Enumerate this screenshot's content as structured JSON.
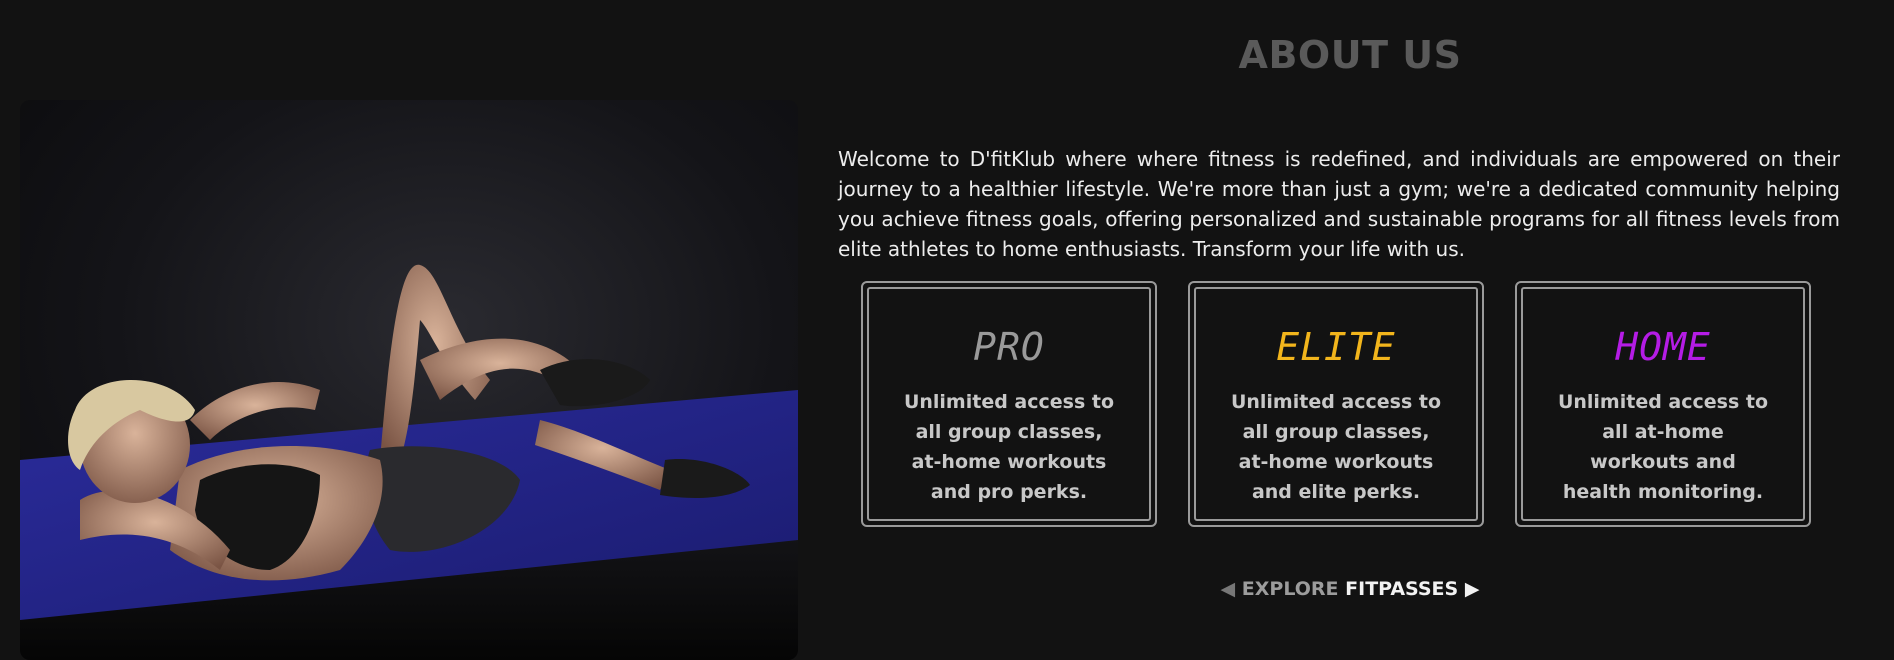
{
  "section": {
    "title": "ABOUT US"
  },
  "intro": {
    "text": "Welcome to D'fitKlub where where fitness is redefined, and individuals are empowered on their journey to a healthier lifestyle. We're more than just a gym; we're a dedicated community helping you achieve fitness goals, offering personalized and sustainable programs for all fitness levels from elite athletes to home enthusiasts. Transform your life with us."
  },
  "plans": [
    {
      "title": "PRO",
      "color": "#9a9a9a",
      "desc": "Unlimited access to all group classes, at-home workouts and pro perks."
    },
    {
      "title": "ELITE",
      "color": "#f2b51c",
      "desc": "Unlimited access to all group classes, at-home workouts and elite perks."
    },
    {
      "title": "HOME",
      "color": "#b51ce6",
      "desc": "Unlimited access to all at-home workouts and health monitoring."
    }
  ],
  "explore": {
    "arrow_left": "◀",
    "word1": "EXPLORE",
    "word2": "FITPASSES",
    "arrow_right": "▶"
  },
  "colors": {
    "background": "#121212",
    "mat": "#23248a",
    "title": "#5a5a5a"
  }
}
